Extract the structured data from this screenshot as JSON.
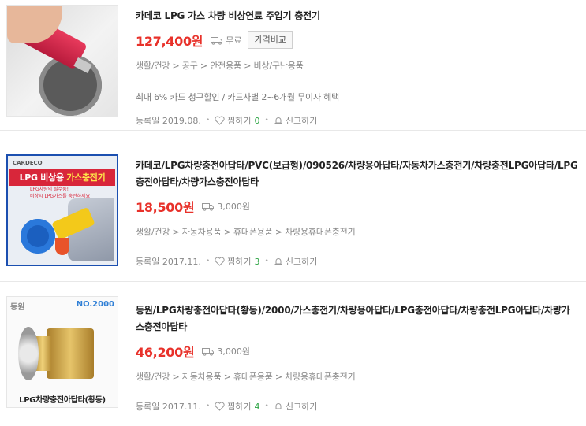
{
  "products": [
    {
      "title": "카데코 LPG 가스 차량 비상연료 주입기 충전기",
      "price": "127,400원",
      "shipping": "무료",
      "compare_label": "가격비교",
      "category": "생활/건강 > 공구 > 안전용품 > 비상/구난용품",
      "benefit": "최대 6% 카드 청구할인 / 카드사별 2~6개월 무이자 혜택",
      "registered": "등록일 2019.08.",
      "wish_label": "찜하기",
      "wish_count": "0",
      "report_label": "신고하기"
    },
    {
      "title": "카데코/LPG차량충전아답타/PVC(보급형)/090526/차량용아답타/자동차가스충전기/차량충전LPG아답타/LPG충전아답타/차량가스충전아답타",
      "price": "18,500원",
      "shipping": "3,000원",
      "category": "생활/건강 > 자동차용품 > 휴대폰용품 > 차량용휴대폰충전기",
      "registered": "등록일 2017.11.",
      "wish_label": "찜하기",
      "wish_count": "3",
      "report_label": "신고하기",
      "thumb": {
        "logo": "CARDECO",
        "title_white": "LPG 비상용 ",
        "title_yellow": "가스충전기",
        "sub_line1": "LPG차량의 필수품!",
        "sub_line2": "비상시 LPG가스를 충전하세요!"
      }
    },
    {
      "title": "동원/LPG차량충전아답타(황동)/2000/가스충전기/차량용아답타/LPG충전아답타/차량충전LPG아답타/차량가스충전아답타",
      "price": "46,200원",
      "shipping": "3,000원",
      "category": "생활/건강 > 자동차용품 > 휴대폰용품 > 차량용휴대폰충전기",
      "registered": "등록일 2017.11.",
      "wish_label": "찜하기",
      "wish_count": "4",
      "report_label": "신고하기",
      "thumb": {
        "logo": "동원",
        "model": "NO.2000",
        "caption": "LPG차량충전아답타(황동)"
      }
    }
  ],
  "colors": {
    "price": "#e8312a",
    "wish_count": "#2ea545",
    "thumb2_border": "#1b4fb0"
  },
  "icons": {
    "shipping": "truck-icon",
    "wish": "heart-icon",
    "report": "bell-icon"
  }
}
